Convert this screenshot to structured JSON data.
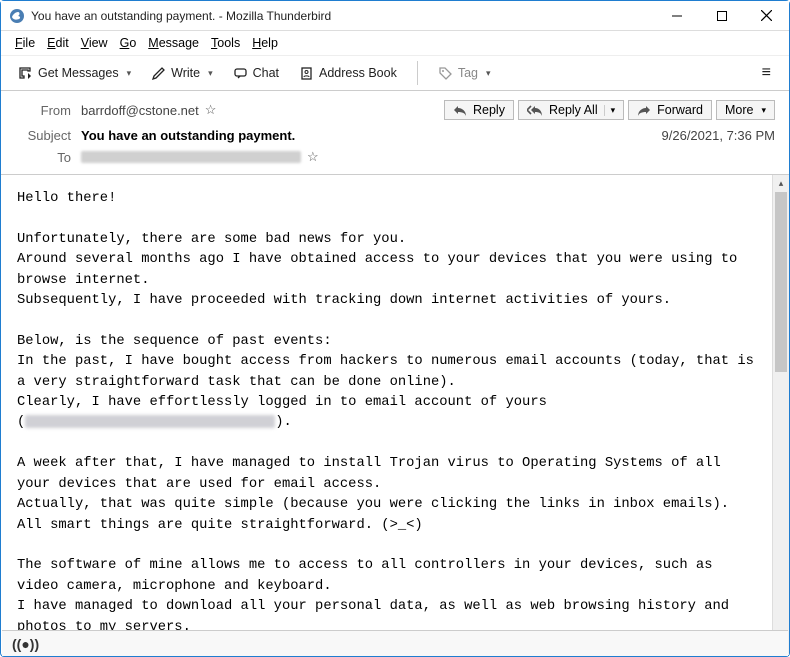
{
  "window": {
    "title": "You have an outstanding payment. - Mozilla Thunderbird"
  },
  "menubar": {
    "file": "File",
    "edit": "Edit",
    "view": "View",
    "go": "Go",
    "message": "Message",
    "tools": "Tools",
    "help": "Help"
  },
  "toolbar": {
    "getmsg": "Get Messages",
    "write": "Write",
    "chat": "Chat",
    "addrbook": "Address Book",
    "tag": "Tag"
  },
  "actions": {
    "reply": "Reply",
    "replyall": "Reply All",
    "forward": "Forward",
    "more": "More"
  },
  "header": {
    "from_label": "From",
    "from_value": "barrdoff@cstone.net",
    "subject_label": "Subject",
    "subject_value": "You have an outstanding payment.",
    "date": "9/26/2021, 7:36 PM",
    "to_label": "To"
  },
  "body": {
    "greeting": "Hello there!",
    "p1l1": "Unfortunately, there are some bad news for you.",
    "p1l2": "Around several months ago I have obtained access to your devices that you were using to browse internet.",
    "p1l3": "Subsequently, I have proceeded with tracking down internet activities of yours.",
    "p2l1": "Below, is the sequence of past events:",
    "p2l2": "In the past, I have bought access from hackers to numerous email accounts (today, that is a very straightforward task that can be done online).",
    "p2l3": "Clearly, I have effortlessly logged in to email account of yours",
    "p2l4a": "(",
    "p2l4b": ").",
    "p3l1": "A week after that, I have managed to install Trojan virus to Operating Systems of all your devices that are used for email access.",
    "p3l2": "Actually, that was quite simple (because you were clicking the links in inbox emails).",
    "p3l3": "All smart things are quite straightforward. (>_<)",
    "p4l1": "The software of mine allows me to access to all controllers in your devices, such as video camera, microphone and keyboard.",
    "p4l2": "I have managed to download all your personal data, as well as web browsing history and photos to my servers."
  }
}
